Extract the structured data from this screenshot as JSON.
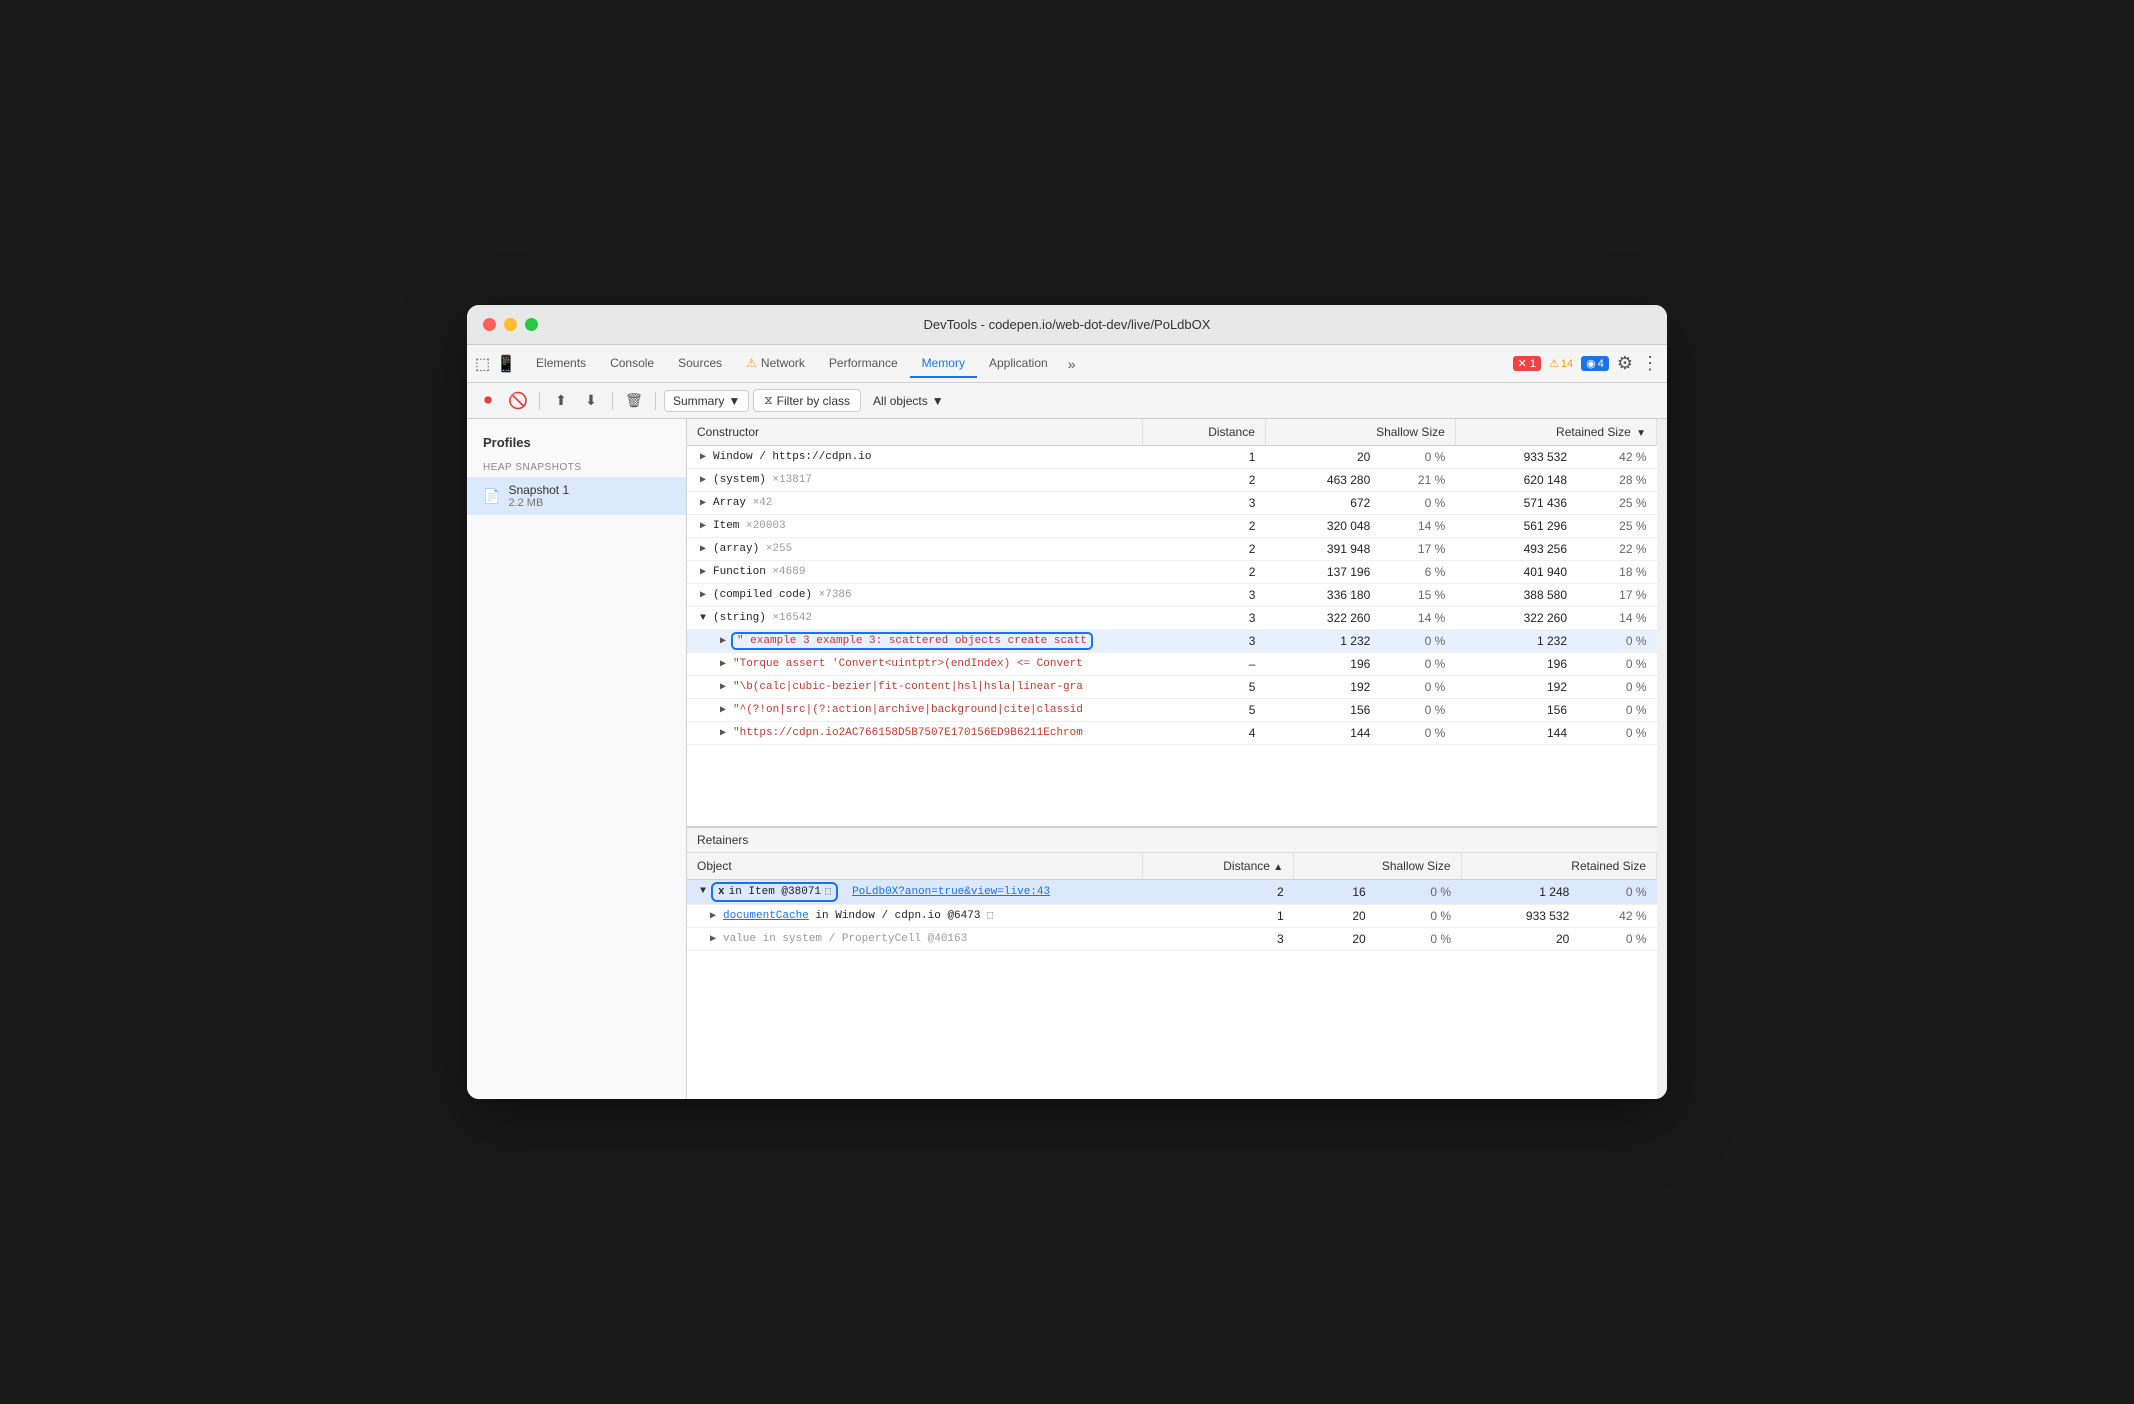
{
  "window": {
    "title": "DevTools - codepen.io/web-dot-dev/live/PoLdbOX"
  },
  "tabs": [
    {
      "label": "Elements",
      "active": false
    },
    {
      "label": "Console",
      "active": false
    },
    {
      "label": "Sources",
      "active": false
    },
    {
      "label": "⚠ Network",
      "active": false,
      "warn": true
    },
    {
      "label": "Performance",
      "active": false
    },
    {
      "label": "Memory",
      "active": true
    },
    {
      "label": "Application",
      "active": false
    }
  ],
  "badges": {
    "errors": "1",
    "warnings": "14",
    "info": "4"
  },
  "toolbar": {
    "summary_label": "Summary",
    "filter_label": "Filter by class",
    "objects_label": "All objects"
  },
  "columns": {
    "constructor": "Constructor",
    "distance": "Distance",
    "shallow_size": "Shallow Size",
    "retained_size": "Retained Size"
  },
  "heap_rows": [
    {
      "constructor": "Window / https://cdpn.io",
      "distance": "1",
      "shallow": "20",
      "shallow_pct": "0 %",
      "retained": "933 532",
      "retained_pct": "42 %",
      "expandable": true
    },
    {
      "constructor": "(system)  ×13817",
      "distance": "2",
      "shallow": "463 280",
      "shallow_pct": "21 %",
      "retained": "620 148",
      "retained_pct": "28 %",
      "expandable": true
    },
    {
      "constructor": "Array  ×42",
      "distance": "3",
      "shallow": "672",
      "shallow_pct": "0 %",
      "retained": "571 436",
      "retained_pct": "25 %",
      "expandable": true
    },
    {
      "constructor": "Item  ×20003",
      "distance": "2",
      "shallow": "320 048",
      "shallow_pct": "14 %",
      "retained": "561 296",
      "retained_pct": "25 %",
      "expandable": true
    },
    {
      "constructor": "(array)  ×255",
      "distance": "2",
      "shallow": "391 948",
      "shallow_pct": "17 %",
      "retained": "493 256",
      "retained_pct": "22 %",
      "expandable": true
    },
    {
      "constructor": "Function  ×4689",
      "distance": "2",
      "shallow": "137 196",
      "shallow_pct": "6 %",
      "retained": "401 940",
      "retained_pct": "18 %",
      "expandable": true
    },
    {
      "constructor": "(compiled code)  ×7386",
      "distance": "3",
      "shallow": "336 180",
      "shallow_pct": "15 %",
      "retained": "388 580",
      "retained_pct": "17 %",
      "expandable": true
    },
    {
      "constructor": "(string)  ×16542",
      "distance": "3",
      "shallow": "322 260",
      "shallow_pct": "14 %",
      "retained": "322 260",
      "retained_pct": "14 %",
      "expandable": true,
      "expanded": true
    }
  ],
  "string_children": [
    {
      "value": "\" example 3 example 3: scattered objects create scatt",
      "distance": "3",
      "shallow": "1 232",
      "shallow_pct": "0 %",
      "retained": "1 232",
      "retained_pct": "0 %",
      "highlighted": true,
      "string": true
    },
    {
      "value": "\"Torque assert 'Convert<uintptr>(endIndex) <= Convert",
      "distance": "–",
      "shallow": "196",
      "shallow_pct": "0 %",
      "retained": "196",
      "retained_pct": "0 %",
      "string": true,
      "red": true
    },
    {
      "value": "\"\\b(calc|cubic-bezier|fit-content|hsl|hsla|linear-gra",
      "distance": "5",
      "shallow": "192",
      "shallow_pct": "0 %",
      "retained": "192",
      "retained_pct": "0 %",
      "string": true,
      "red": true
    },
    {
      "value": "\"^(?!on|src|(?:action|archive|background|cite|classid",
      "distance": "5",
      "shallow": "156",
      "shallow_pct": "0 %",
      "retained": "156",
      "retained_pct": "0 %",
      "string": true,
      "red": true
    },
    {
      "value": "\"https://cdpn.io2AC766158D5B7507E170156ED9B6211Echrom",
      "distance": "4",
      "shallow": "144",
      "shallow_pct": "0 %",
      "retained": "144",
      "retained_pct": "0 %",
      "string": true,
      "red": true
    }
  ],
  "retainers": {
    "label": "Retainers",
    "columns": {
      "object": "Object",
      "distance": "Distance",
      "shallow_size": "Shallow Size",
      "retained_size": "Retained Size"
    },
    "rows": [
      {
        "object": "x in Item @38071",
        "link": "PoLdb0X?anon=true&view=live:43",
        "distance": "2",
        "shallow": "16",
        "shallow_pct": "0 %",
        "retained": "1 248",
        "retained_pct": "0 %",
        "selected": true,
        "has_window": true
      },
      {
        "object": "documentCache in Window / cdpn.io @6473",
        "distance": "1",
        "shallow": "20",
        "shallow_pct": "0 %",
        "retained": "933 532",
        "retained_pct": "42 %",
        "has_window": true
      },
      {
        "object": "value in system / PropertyCell @40163",
        "distance": "3",
        "shallow": "20",
        "shallow_pct": "0 %",
        "retained": "20",
        "retained_pct": "0 %"
      }
    ]
  },
  "sidebar": {
    "title": "Profiles",
    "section_label": "HEAP SNAPSHOTS",
    "snapshot": {
      "name": "Snapshot 1",
      "size": "2.2 MB"
    }
  }
}
